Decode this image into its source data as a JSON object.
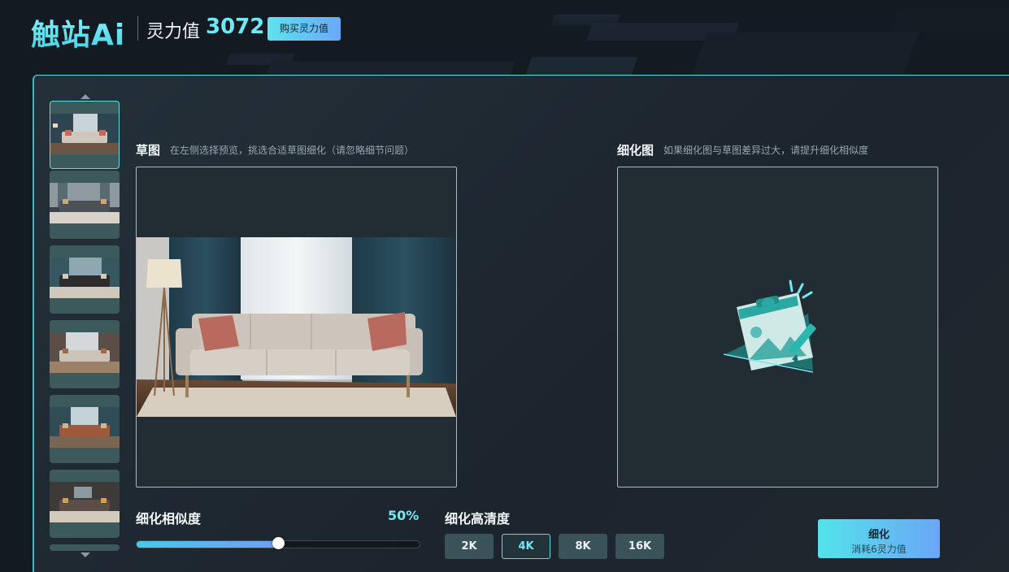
{
  "header": {
    "logo": "触站Ai",
    "power_label": "灵力值",
    "power_value": "3072",
    "buy_button": "购买灵力值"
  },
  "sketch": {
    "title": "草图",
    "hint": "在左侧选择预览，挑选合适草图细化（请忽略细节问题）"
  },
  "refined": {
    "title": "细化图",
    "hint": "如果细化图与草图差异过大，请提升细化相似度"
  },
  "similarity": {
    "label": "细化相似度",
    "value_text": "50%",
    "value": 50
  },
  "resolution": {
    "label": "细化高清度",
    "options": [
      "2K",
      "4K",
      "8K",
      "16K"
    ],
    "selected": "4K"
  },
  "refine_button": {
    "label": "细化",
    "cost": "消耗6灵力值"
  },
  "colors": {
    "accent": "#5fdbe6",
    "accent_text": "#6fe9f5",
    "panel": "#222d33"
  },
  "icons": {
    "thumb_up": "chevron-up-icon",
    "thumb_down": "chevron-down-icon",
    "placeholder": "image-placeholder-icon"
  }
}
